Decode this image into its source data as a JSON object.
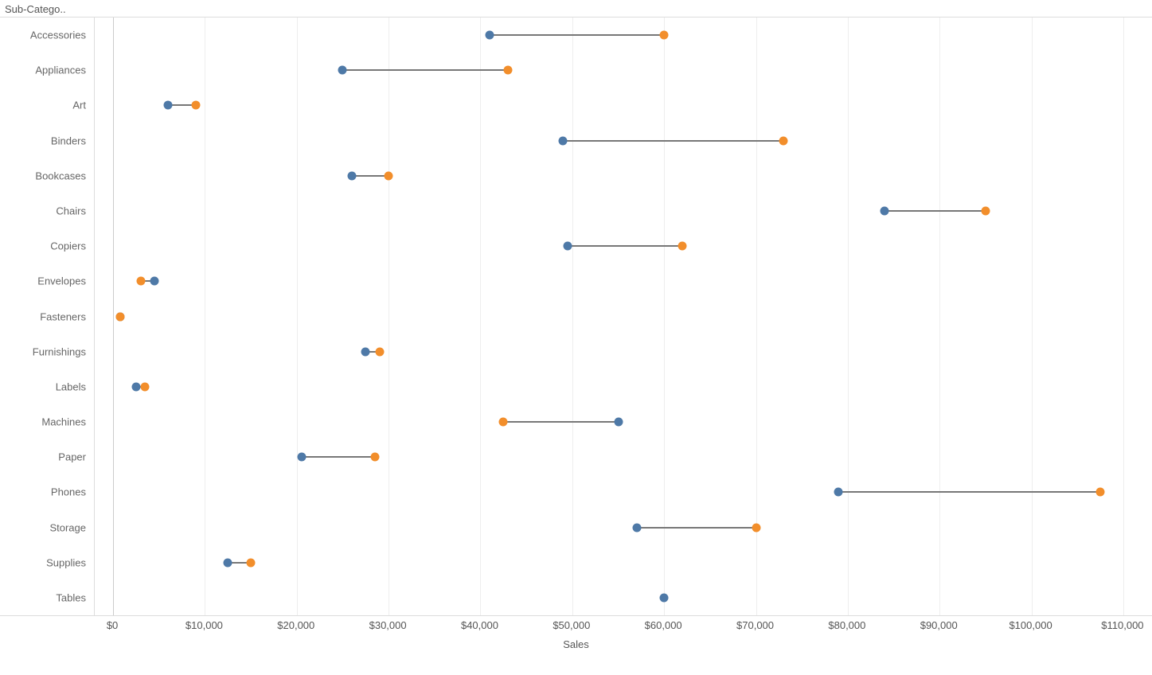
{
  "header_label": "Sub-Catego..",
  "x_axis_title": "Sales",
  "x_axis": {
    "min": -2000,
    "max": 112000,
    "ticks": [
      0,
      10000,
      20000,
      30000,
      40000,
      50000,
      60000,
      70000,
      80000,
      90000,
      100000,
      110000
    ],
    "tick_labels": [
      "$0",
      "$10,000",
      "$20,000",
      "$30,000",
      "$40,000",
      "$50,000",
      "$60,000",
      "$70,000",
      "$80,000",
      "$90,000",
      "$100,000",
      "$110,000"
    ]
  },
  "colors": {
    "blue": "#4e79a7",
    "orange": "#f28e2b",
    "connector": "#777"
  },
  "chart_data": {
    "type": "dumbbell",
    "xlabel": "Sales",
    "ylabel": "Sub-Category",
    "xlim": [
      -2000,
      112000
    ],
    "categories": [
      "Accessories",
      "Appliances",
      "Art",
      "Binders",
      "Bookcases",
      "Chairs",
      "Copiers",
      "Envelopes",
      "Fasteners",
      "Furnishings",
      "Labels",
      "Machines",
      "Paper",
      "Phones",
      "Storage",
      "Supplies",
      "Tables"
    ],
    "series": [
      {
        "name": "Blue",
        "color": "#4e79a7",
        "values": [
          41000,
          25000,
          6000,
          49000,
          26000,
          84000,
          49500,
          4500,
          800,
          27500,
          2500,
          55000,
          20500,
          79000,
          57000,
          12500,
          60000
        ]
      },
      {
        "name": "Orange",
        "color": "#f28e2b",
        "values": [
          60000,
          43000,
          9000,
          73000,
          30000,
          95000,
          62000,
          3000,
          800,
          29000,
          3500,
          42500,
          28500,
          107500,
          70000,
          15000,
          null
        ]
      }
    ]
  }
}
